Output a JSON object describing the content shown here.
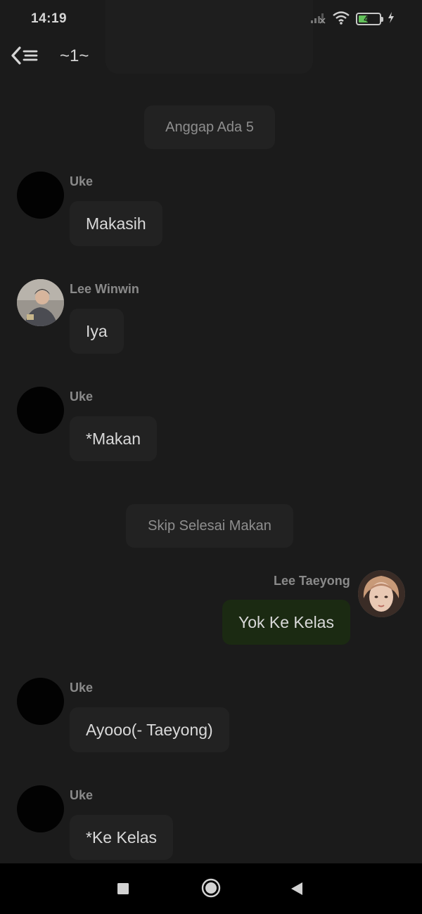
{
  "status_bar": {
    "time": "14:19",
    "battery_level": "45",
    "icons": [
      "signal-icon",
      "wifi-icon",
      "battery-icon",
      "charging-icon"
    ]
  },
  "header": {
    "title": "~1~",
    "back_icon": "back-menu-icon"
  },
  "messages": [
    {
      "type": "narration",
      "text": "Anggap Ada 5"
    },
    {
      "type": "incoming",
      "sender": "Uke",
      "text": "Makasih",
      "avatar": "blank"
    },
    {
      "type": "incoming",
      "sender": "Lee Winwin",
      "text": "Iya",
      "avatar": "photo"
    },
    {
      "type": "incoming",
      "sender": "Uke",
      "text": "*Makan",
      "avatar": "blank"
    },
    {
      "type": "narration",
      "text": "Skip Selesai Makan"
    },
    {
      "type": "outgoing",
      "sender": "Lee Taeyong",
      "text": "Yok Ke Kelas",
      "avatar": "photo"
    },
    {
      "type": "incoming",
      "sender": "Uke",
      "text": "Ayooo(- Taeyong)",
      "avatar": "blank"
    },
    {
      "type": "incoming",
      "sender": "Uke",
      "text": "*Ke Kelas",
      "avatar": "blank"
    }
  ],
  "system_nav": {
    "icons": [
      "recent-apps-icon",
      "home-icon",
      "back-icon"
    ]
  },
  "colors": {
    "background": "#1b1b1b",
    "bubble": "#222222",
    "outgoing_bubble": "#1b2a12",
    "battery_green": "#62c15a"
  }
}
